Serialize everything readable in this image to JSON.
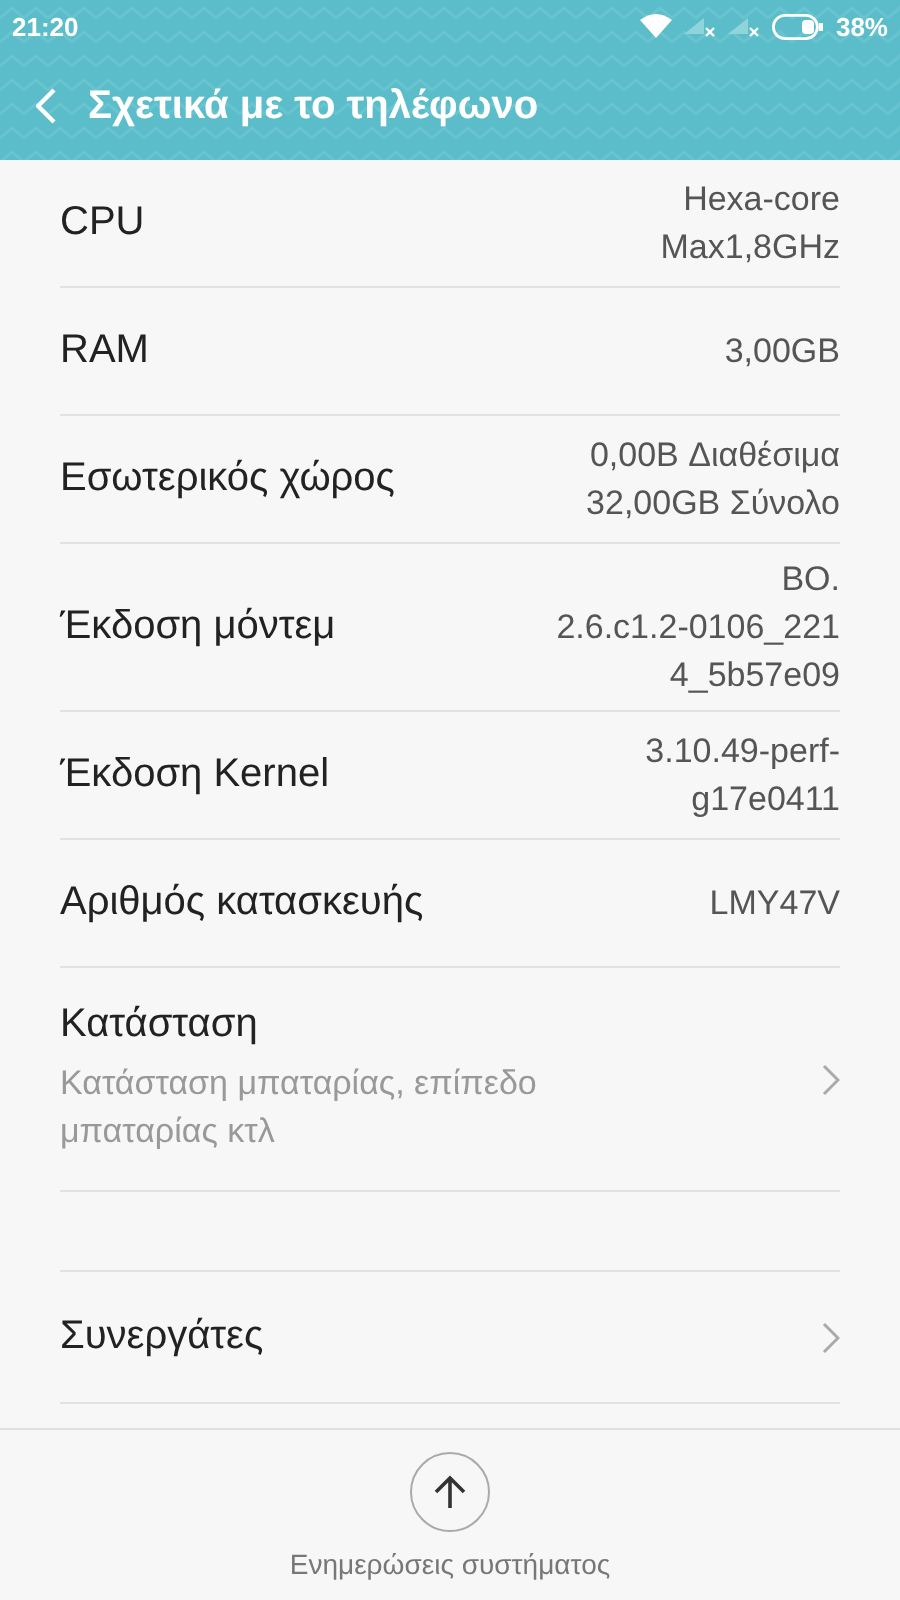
{
  "status_bar": {
    "time": "21:20",
    "battery": "38%"
  },
  "header": {
    "title": "Σχετικά με το τηλέφωνο"
  },
  "items": [
    {
      "kind": "info",
      "label": "CPU",
      "value": [
        "Hexa-core",
        "Max1,8GHz"
      ]
    },
    {
      "kind": "info",
      "label": "RAM",
      "value": [
        "3,00GB"
      ]
    },
    {
      "kind": "info",
      "label": "Εσωτερικός χώρος",
      "value": [
        "0,00B Διαθέσιμα",
        "32,00GB Σύνολο"
      ]
    },
    {
      "kind": "info",
      "label": "Έκδοση μόντεμ",
      "value": [
        "BO.",
        "2.6.c1.2-0106_221",
        "4_5b57e09"
      ]
    },
    {
      "kind": "info",
      "label": "Έκδοση Kernel",
      "value": [
        "3.10.49-perf-",
        "g17e0411"
      ]
    },
    {
      "kind": "info",
      "label": "Αριθμός κατασκευής",
      "value": [
        "LMY47V"
      ]
    },
    {
      "kind": "nav",
      "label": "Κατάσταση",
      "subtitle": "Κατάσταση μπαταρίας, επίπεδο μπαταρίας κτλ"
    },
    {
      "kind": "spacer"
    },
    {
      "kind": "nav",
      "label": "Συνεργάτες"
    }
  ],
  "footer": {
    "label": "Ενημερώσεις συστήματος"
  }
}
